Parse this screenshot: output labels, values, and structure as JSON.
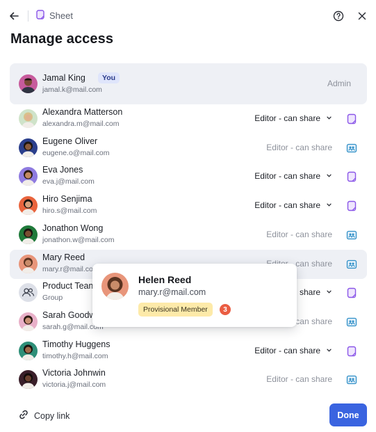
{
  "header": {
    "breadcrumb": "Sheet",
    "title": "Manage access"
  },
  "owner": {
    "name": "Jamal King",
    "badge": "You",
    "email": "jamal.k@mail.com",
    "role": "Admin"
  },
  "members": [
    {
      "name": "Alexandra Matterson",
      "email": "alexandra.m@mail.com",
      "role": "Editor - can share",
      "editable": true,
      "source": "doc-icon"
    },
    {
      "name": "Eugene Oliver",
      "email": "eugene.o@mail.com",
      "role": "Editor - can share",
      "editable": false,
      "source": "group-card-icon"
    },
    {
      "name": "Eva Jones",
      "email": "eva.j@mail.com",
      "role": "Editor - can share",
      "editable": true,
      "source": "doc-icon"
    },
    {
      "name": "Hiro Senjima",
      "email": "hiro.s@mail.com",
      "role": "Editor - can share",
      "editable": true,
      "source": "doc-icon"
    },
    {
      "name": "Jonathon Wong",
      "email": "jonathon.w@mail.com",
      "role": "Editor - can share",
      "editable": false,
      "source": "group-card-icon"
    },
    {
      "name": "Mary Reed",
      "email": "mary.r@mail.com",
      "role": "Editor - can share",
      "editable": false,
      "source": "group-card-icon"
    },
    {
      "name": "Product Team",
      "email": "Group",
      "role": "Editor - can share",
      "editable": true,
      "source": "doc-icon"
    },
    {
      "name": "Sarah Goodwin",
      "email": "sarah.g@mail.com",
      "role": "Editor - can share",
      "editable": false,
      "source": "group-card-icon"
    },
    {
      "name": "Timothy Huggens",
      "email": "timothy.h@mail.com",
      "role": "Editor - can share",
      "editable": true,
      "source": "doc-icon"
    },
    {
      "name": "Victoria Johnwin",
      "email": "victoria.j@mail.com",
      "role": "Editor - can share",
      "editable": false,
      "source": "group-card-icon"
    }
  ],
  "popover": {
    "name": "Helen Reed",
    "email": "mary.r@mail.com",
    "badge": "Provisional Member",
    "count": "3"
  },
  "footer": {
    "copy_link": "Copy link",
    "done": "Done"
  },
  "colors": {
    "accent": "#3a64e0",
    "doc_icon": "#8a56e8",
    "group_icon": "#2f8fc7",
    "badge_bg": "#fdeaa9",
    "count_bg": "#ea5d42"
  }
}
